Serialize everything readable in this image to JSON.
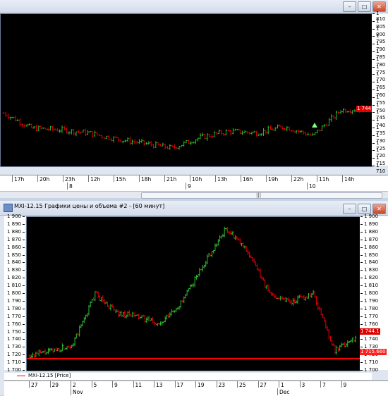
{
  "top_chart": {
    "y_ticks": [
      "1 810",
      "1 805",
      "1 800",
      "1 795",
      "1 790",
      "1 785",
      "1 780",
      "1 775",
      "1 770",
      "1 765",
      "1 760",
      "1 755",
      "1 750",
      "1 745",
      "1 740",
      "1 735",
      "1 730",
      "1 725",
      "1 720",
      "1 715",
      "1 710"
    ],
    "last_price": "1 744",
    "x_ticks": [
      "17h",
      "20h",
      "23h",
      "12h",
      "15h",
      "18h",
      "21h",
      "10h",
      "13h",
      "16h",
      "19h",
      "22h",
      "11h",
      "14h"
    ],
    "x_dates": [
      "8",
      "9",
      "10"
    ]
  },
  "bottom_window": {
    "title": "MXI-12.15 Графики цены и объема #2 - [60 минут]",
    "y_ticks": [
      "1 900",
      "1 890",
      "1 880",
      "1 870",
      "1 860",
      "1 850",
      "1 840",
      "1 830",
      "1 820",
      "1 810",
      "1 800",
      "1 790",
      "1 780",
      "1 770",
      "1 760",
      "1 750",
      "1 740",
      "1 730",
      "1 720",
      "1 710",
      "1 700"
    ],
    "last_price": "1 744.1",
    "hline_price": "1 715.660",
    "legend": "MXI-12.15 [Price]",
    "x_ticks": [
      "27",
      "29",
      "2",
      "5",
      "9",
      "11",
      "13",
      "17",
      "19",
      "23",
      "25",
      "27",
      "1",
      "3",
      "7",
      "9"
    ],
    "x_months": [
      "Nov",
      "Dec"
    ]
  },
  "window_buttons": {
    "minimize": "–",
    "maximize": "□",
    "close": "✕"
  },
  "colors": {
    "up": "#2fbf2f",
    "down": "#e00000",
    "hline": "#ff0000",
    "marker": "#7fff7f"
  },
  "chart_data": [
    {
      "type": "line",
      "title": "",
      "ylim": [
        1710,
        1810
      ],
      "x": [
        "17h",
        "20h",
        "23h",
        "12h",
        "15h",
        "18h",
        "21h",
        "10h",
        "13h",
        "16h",
        "19h",
        "22h",
        "11h",
        "14h"
      ],
      "series": [
        {
          "values": [
            1745,
            1735,
            1734,
            1732,
            1728,
            1725,
            1722,
            1729,
            1733,
            1732,
            1736,
            1730,
            1747,
            1748
          ]
        }
      ]
    },
    {
      "type": "line",
      "title": "",
      "ylim": [
        1700,
        1900
      ],
      "x": [
        "27",
        "29",
        "2",
        "5",
        "9",
        "11",
        "13",
        "17",
        "19",
        "23",
        "25",
        "27",
        "1",
        "3",
        "7",
        "9"
      ],
      "series": [
        {
          "name": "MXI-12.15 [Price]",
          "values": [
            1720,
            1725,
            1735,
            1800,
            1775,
            1770,
            1760,
            1790,
            1840,
            1885,
            1855,
            1800,
            1790,
            1800,
            1725,
            1745
          ]
        }
      ],
      "hline": 1715.66
    }
  ]
}
